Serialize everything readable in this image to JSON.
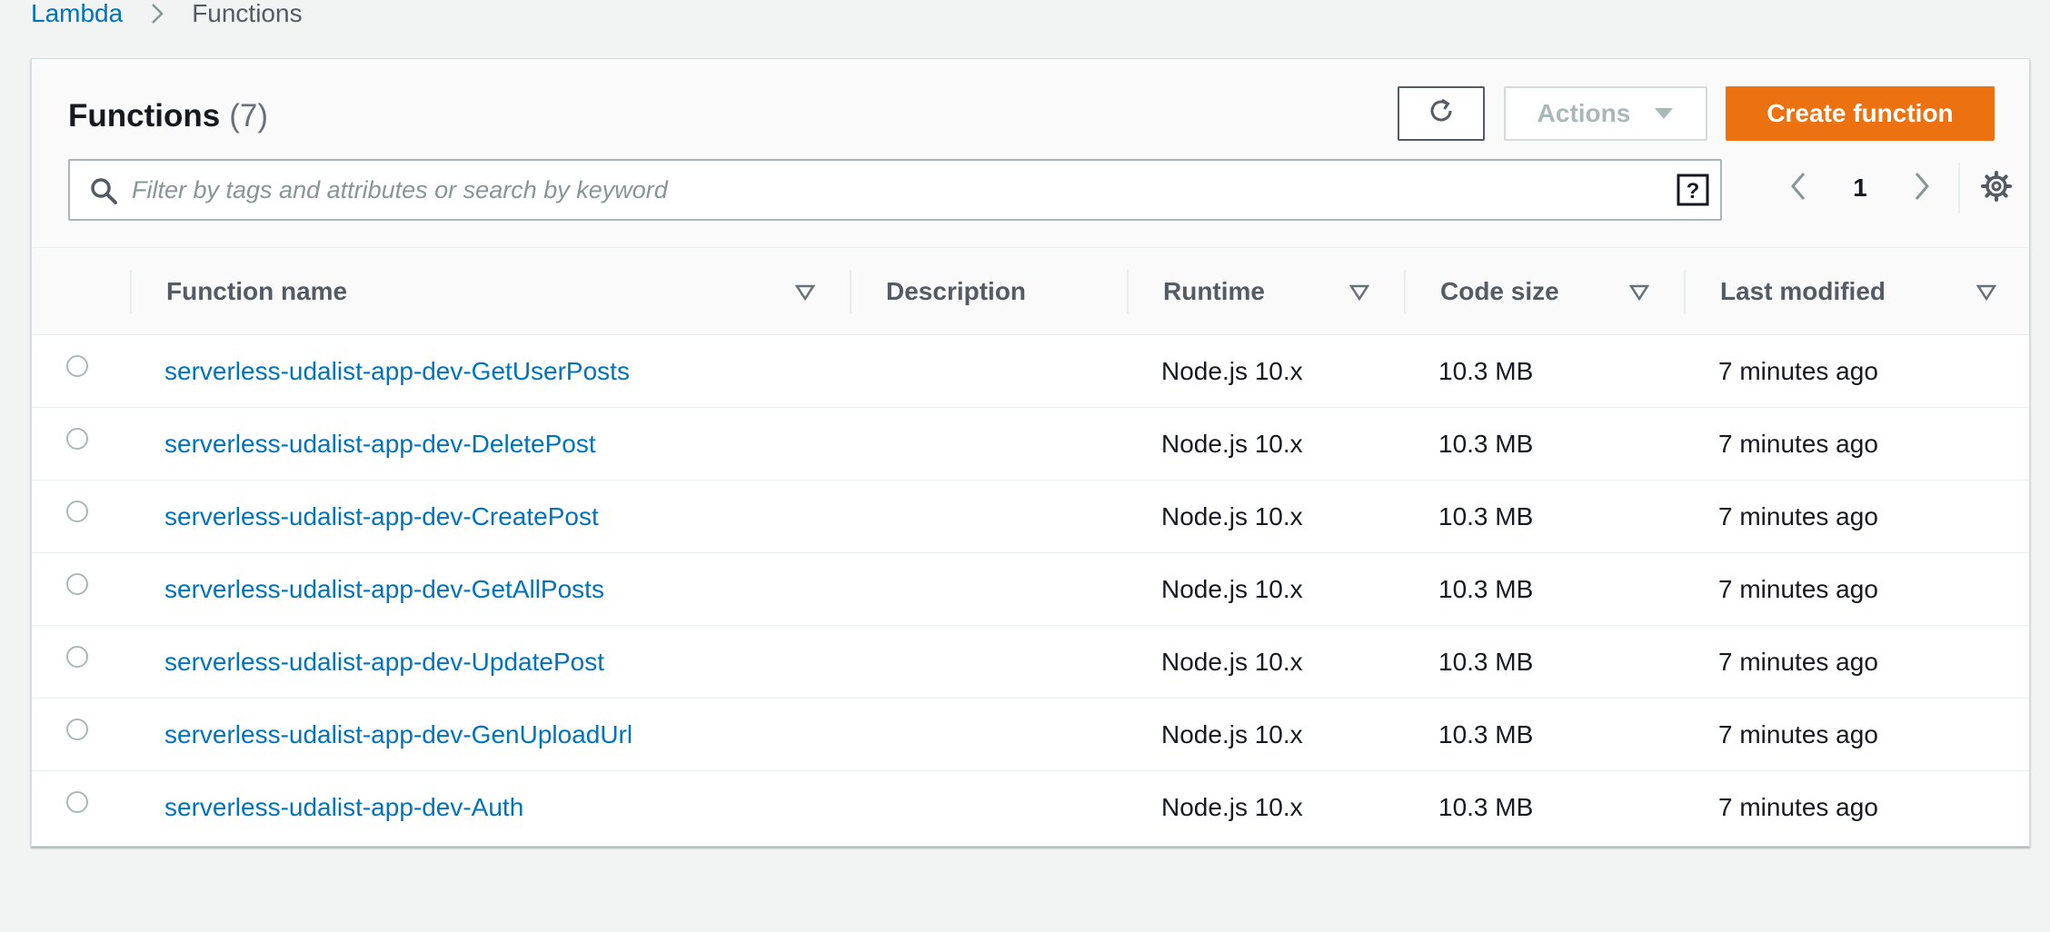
{
  "breadcrumb": {
    "root": "Lambda",
    "current": "Functions"
  },
  "panel": {
    "title": "Functions",
    "count": "(7)"
  },
  "toolbar": {
    "actions_label": "Actions",
    "create_label": "Create function"
  },
  "search": {
    "placeholder": "Filter by tags and attributes or search by keyword",
    "value": ""
  },
  "pagination": {
    "current_page": "1"
  },
  "table": {
    "columns": [
      "Function name",
      "Description",
      "Runtime",
      "Code size",
      "Last modified"
    ],
    "rows": [
      {
        "name": "serverless-udalist-app-dev-GetUserPosts",
        "description": "",
        "runtime": "Node.js 10.x",
        "code_size": "10.3 MB",
        "last_modified": "7 minutes ago"
      },
      {
        "name": "serverless-udalist-app-dev-DeletePost",
        "description": "",
        "runtime": "Node.js 10.x",
        "code_size": "10.3 MB",
        "last_modified": "7 minutes ago"
      },
      {
        "name": "serverless-udalist-app-dev-CreatePost",
        "description": "",
        "runtime": "Node.js 10.x",
        "code_size": "10.3 MB",
        "last_modified": "7 minutes ago"
      },
      {
        "name": "serverless-udalist-app-dev-GetAllPosts",
        "description": "",
        "runtime": "Node.js 10.x",
        "code_size": "10.3 MB",
        "last_modified": "7 minutes ago"
      },
      {
        "name": "serverless-udalist-app-dev-UpdatePost",
        "description": "",
        "runtime": "Node.js 10.x",
        "code_size": "10.3 MB",
        "last_modified": "7 minutes ago"
      },
      {
        "name": "serverless-udalist-app-dev-GenUploadUrl",
        "description": "",
        "runtime": "Node.js 10.x",
        "code_size": "10.3 MB",
        "last_modified": "7 minutes ago"
      },
      {
        "name": "serverless-udalist-app-dev-Auth",
        "description": "",
        "runtime": "Node.js 10.x",
        "code_size": "10.3 MB",
        "last_modified": "7 minutes ago"
      }
    ]
  },
  "icons": {
    "breadcrumb_separator": "chevron-right-icon",
    "refresh": "refresh-icon",
    "actions_caret": "caret-down-icon",
    "search": "search-icon",
    "help": "help-icon",
    "prev": "chevron-left-icon",
    "next": "chevron-right-icon",
    "settings": "gear-icon",
    "sort": "sort-triangle-icon"
  },
  "colors": {
    "link": "#0073bb",
    "primary": "#ec7211",
    "background": "#f2f3f3"
  }
}
